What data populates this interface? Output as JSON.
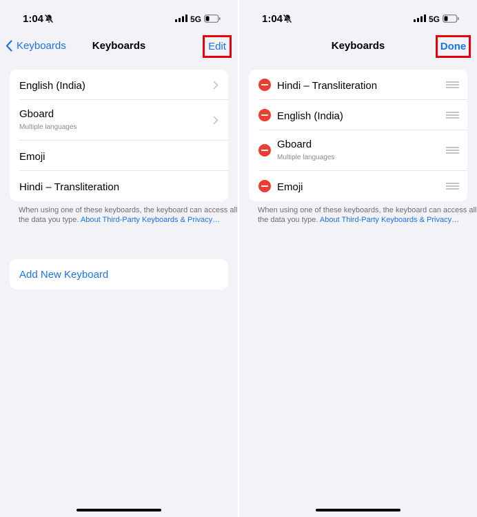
{
  "status": {
    "time": "1:04",
    "network": "5G"
  },
  "left": {
    "back_label": "Keyboards",
    "title": "Keyboards",
    "edit_label": "Edit",
    "keyboards": [
      {
        "label": "English (India)",
        "sub": ""
      },
      {
        "label": "Gboard",
        "sub": "Multiple languages"
      },
      {
        "label": "Emoji",
        "sub": ""
      },
      {
        "label": "Hindi – Transliteration",
        "sub": ""
      }
    ],
    "footer_text": "When using one of these keyboards, the keyboard can access all the data you type.",
    "footer_link": "About Third-Party Keyboards & Privacy…",
    "add_label": "Add New Keyboard"
  },
  "right": {
    "title": "Keyboards",
    "done_label": "Done",
    "keyboards": [
      {
        "label": "Hindi – Transliteration",
        "sub": ""
      },
      {
        "label": "English (India)",
        "sub": ""
      },
      {
        "label": "Gboard",
        "sub": "Multiple languages"
      },
      {
        "label": "Emoji",
        "sub": ""
      }
    ],
    "footer_text": "When using one of these keyboards, the keyboard can access all the data you type.",
    "footer_link": "About Third-Party Keyboards & Privacy…"
  },
  "colors": {
    "accent": "#1a73e8",
    "highlight": "#e8000b",
    "delete": "#ef3b30"
  }
}
